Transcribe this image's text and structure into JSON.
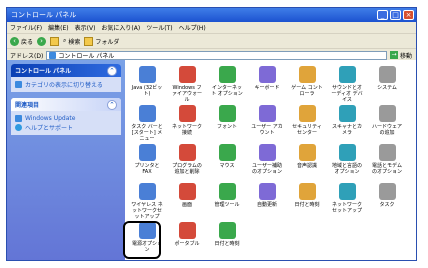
{
  "window": {
    "title": "コントロール パネル",
    "buttons": {
      "min": "_",
      "max": "□",
      "close": "×"
    }
  },
  "menu": [
    "ファイル(F)",
    "編集(E)",
    "表示(V)",
    "お気に入り(A)",
    "ツール(T)",
    "ヘルプ(H)"
  ],
  "toolbar": {
    "back": "戻る",
    "search": "検索",
    "folders": "フォルダ"
  },
  "address": {
    "label": "アドレス(D)",
    "value": "コントロール パネル",
    "go": "移動"
  },
  "sidebar": {
    "panel1_title": "コントロール パネル",
    "panel1_link": "カテゴリの表示に切り替える",
    "panel2_title": "関連項目",
    "panel2_links": [
      "Windows Update",
      "ヘルプとサポート"
    ]
  },
  "items": [
    "Java (32ビット)",
    "Windows ファイアウォール",
    "インターネット オプション",
    "キーボード",
    "ゲーム コントローラ",
    "サウンドとオーディオ デバイス",
    "システム",
    "タスク バーと [スタート] メニュー",
    "ネットワーク接続",
    "フォント",
    "ユーザー アカウント",
    "セキュリティ センター",
    "スキャナとカメラ",
    "ハードウェアの追加",
    "プリンタとFAX",
    "プログラムの追加と削除",
    "マウス",
    "ユーザー補助のオプション",
    "音声認識",
    "地域と言語のオプション",
    "電話とモデムのオプション",
    "ワイヤレス ネットワークセットアップ",
    "画面",
    "管理ツール",
    "自動更新",
    "日付と時刻",
    "ネットワークセットアップ",
    "タスク",
    "電源オプション",
    "ポータブル",
    "日付と時刻"
  ]
}
